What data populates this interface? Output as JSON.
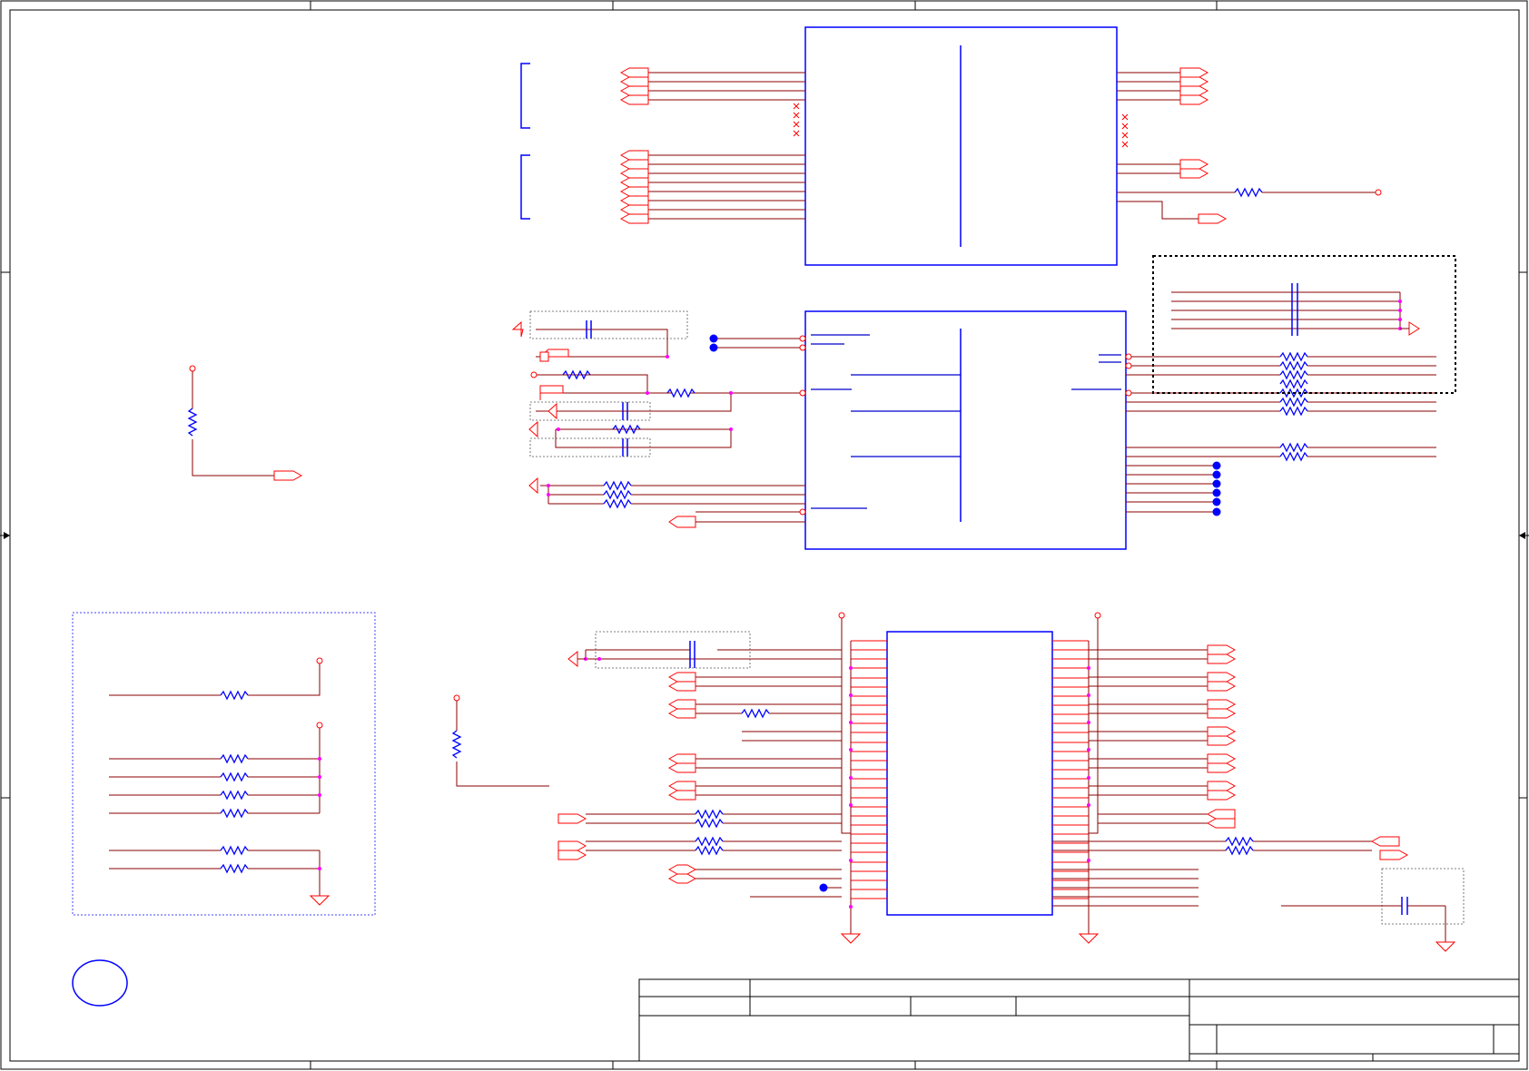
{
  "sheet": {
    "frame_color": "#000000",
    "wire_color": "#990000",
    "net_color": "#ff0000",
    "part_color": "#0000cc",
    "junction_color": "#cc00cc",
    "text": []
  },
  "title_block": {
    "fields": []
  },
  "colors": {
    "wire": "#8b0000",
    "bus_stub": "#ff0000",
    "component": "#0000ff",
    "junction": "#ff00ff",
    "frame": "#000000",
    "group_box": "#666666",
    "group_box_blue": "#4444ff"
  }
}
